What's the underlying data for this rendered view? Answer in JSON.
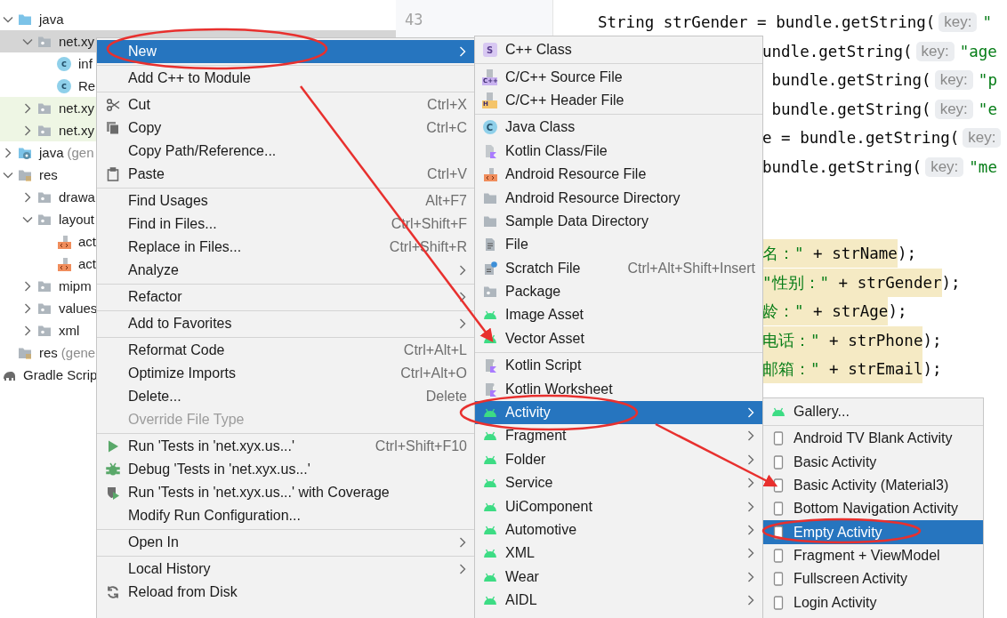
{
  "project_tree": [
    {
      "label": "java",
      "kind": "java-folder",
      "expanded": true,
      "selected": false,
      "test": false,
      "children": [
        {
          "label": "net.xy",
          "kind": "package",
          "expanded": true,
          "selected": true,
          "test": false,
          "children": [
            {
              "label": "inf",
              "kind": "class",
              "badge": "c",
              "selected": false,
              "test": false
            },
            {
              "label": "Re",
              "kind": "class",
              "badge": "c",
              "selected": false,
              "test": false
            }
          ]
        },
        {
          "label": "net.xy",
          "kind": "package",
          "expanded": false,
          "selected": false,
          "test": true
        },
        {
          "label": "net.xy",
          "kind": "package",
          "expanded": false,
          "selected": false,
          "test": true
        }
      ]
    },
    {
      "label": "java",
      "hint": "(gen",
      "kind": "gen-folder",
      "expanded": false,
      "selected": false,
      "test": false
    },
    {
      "label": "res",
      "kind": "res-folder",
      "expanded": true,
      "selected": false,
      "test": false,
      "children": [
        {
          "label": "drawa",
          "kind": "package",
          "expanded": false,
          "selected": false,
          "test": false
        },
        {
          "label": "layout",
          "kind": "package",
          "expanded": true,
          "selected": false,
          "test": false,
          "children": [
            {
              "label": "act",
              "kind": "resource-file",
              "selected": false,
              "test": false
            },
            {
              "label": "act",
              "kind": "resource-file",
              "selected": false,
              "test": false
            }
          ]
        },
        {
          "label": "mipm",
          "kind": "package",
          "expanded": false,
          "selected": false,
          "test": false
        },
        {
          "label": "values",
          "kind": "package",
          "expanded": false,
          "selected": false,
          "test": false
        },
        {
          "label": "xml",
          "kind": "package",
          "expanded": false,
          "selected": false,
          "test": false
        }
      ]
    },
    {
      "label": "res",
      "hint": "(gene",
      "kind": "res-folder",
      "selected": false,
      "test": false
    },
    {
      "label": "Gradle Scrip",
      "kind": "gradle",
      "selected": false,
      "test": false
    }
  ],
  "editor": {
    "line_number": "43",
    "lines": [
      {
        "kind": "full",
        "segments": [
          {
            "text": "String strGender = bundle.getString(",
            "kind": "code",
            "marked": false
          },
          {
            "text": "key:",
            "kind": "hint"
          },
          {
            "text": "\"",
            "kind": "string",
            "marked": false
          }
        ]
      },
      {
        "kind": "clipped",
        "segments": [
          {
            "text": "undle.getString(",
            "kind": "code",
            "marked": false
          },
          {
            "text": "key:",
            "kind": "hint"
          },
          {
            "text": "\"age",
            "kind": "string",
            "marked": false
          }
        ]
      },
      {
        "kind": "clipped",
        "segments": [
          {
            "text": " bundle.getString(",
            "kind": "code",
            "marked": false
          },
          {
            "text": "key:",
            "kind": "hint"
          },
          {
            "text": "\"p",
            "kind": "string",
            "marked": false
          }
        ]
      },
      {
        "kind": "clipped",
        "segments": [
          {
            "text": " bundle.getString(",
            "kind": "code",
            "marked": false
          },
          {
            "text": "key:",
            "kind": "hint"
          },
          {
            "text": "\"e",
            "kind": "string",
            "marked": false
          }
        ]
      },
      {
        "kind": "clipped",
        "segments": [
          {
            "text": "e = bundle.getString(",
            "kind": "code",
            "marked": false
          },
          {
            "text": "key:",
            "kind": "hint"
          }
        ]
      },
      {
        "kind": "clipped",
        "segments": [
          {
            "text": "bundle.getString(",
            "kind": "code",
            "marked": false
          },
          {
            "text": "key:",
            "kind": "hint"
          },
          {
            "text": "\"me",
            "kind": "string",
            "marked": false
          }
        ]
      },
      {
        "kind": "blank"
      },
      {
        "kind": "blank"
      },
      {
        "kind": "clipped",
        "segments": [
          {
            "text": "名：\"",
            "kind": "string",
            "marked": true
          },
          {
            "text": " + strName",
            "kind": "code",
            "marked": true
          },
          {
            "text": ");",
            "kind": "code",
            "marked": false
          }
        ]
      },
      {
        "kind": "clipped",
        "segments": [
          {
            "text": "\"性别：\"",
            "kind": "string",
            "marked": true
          },
          {
            "text": " + strGender",
            "kind": "code",
            "marked": true
          },
          {
            "text": ");",
            "kind": "code",
            "marked": false
          }
        ]
      },
      {
        "kind": "clipped",
        "segments": [
          {
            "text": "龄：\"",
            "kind": "string",
            "marked": true
          },
          {
            "text": " + strAge",
            "kind": "code",
            "marked": true
          },
          {
            "text": ");",
            "kind": "code",
            "marked": false
          }
        ]
      },
      {
        "kind": "clipped",
        "segments": [
          {
            "text": "电话：\"",
            "kind": "string",
            "marked": true
          },
          {
            "text": " + strPhone",
            "kind": "code",
            "marked": true
          },
          {
            "text": ");",
            "kind": "code",
            "marked": false
          }
        ]
      },
      {
        "kind": "clipped",
        "segments": [
          {
            "text": "邮箱：\"",
            "kind": "string",
            "marked": true
          },
          {
            "text": " + strEmail",
            "kind": "code",
            "marked": true
          },
          {
            "text": ");",
            "kind": "code",
            "marked": false
          }
        ]
      }
    ]
  },
  "context_menu": {
    "groups": [
      [
        {
          "label": "New",
          "selected": true,
          "submenu": true,
          "disabled": false
        }
      ],
      [
        {
          "label": "Add C++ to Module",
          "selected": false,
          "submenu": false,
          "disabled": false
        }
      ],
      [
        {
          "label": "Cut",
          "kind": "cut",
          "shortcut": "Ctrl+X",
          "selected": false,
          "submenu": false,
          "disabled": false
        },
        {
          "label": "Copy",
          "kind": "copy",
          "shortcut": "Ctrl+C",
          "selected": false,
          "submenu": false,
          "disabled": false
        },
        {
          "label": "Copy Path/Reference...",
          "selected": false,
          "submenu": false,
          "disabled": false
        },
        {
          "label": "Paste",
          "kind": "paste",
          "shortcut": "Ctrl+V",
          "selected": false,
          "submenu": false,
          "disabled": false
        }
      ],
      [
        {
          "label": "Find Usages",
          "shortcut": "Alt+F7",
          "selected": false,
          "submenu": false,
          "disabled": false
        },
        {
          "label": "Find in Files...",
          "shortcut": "Ctrl+Shift+F",
          "selected": false,
          "submenu": false,
          "disabled": false
        },
        {
          "label": "Replace in Files...",
          "shortcut": "Ctrl+Shift+R",
          "selected": false,
          "submenu": false,
          "disabled": false
        },
        {
          "label": "Analyze",
          "selected": false,
          "submenu": true,
          "disabled": false
        }
      ],
      [
        {
          "label": "Refactor",
          "selected": false,
          "submenu": true,
          "disabled": false
        }
      ],
      [
        {
          "label": "Add to Favorites",
          "selected": false,
          "submenu": true,
          "disabled": false
        }
      ],
      [
        {
          "label": "Reformat Code",
          "shortcut": "Ctrl+Alt+L",
          "selected": false,
          "submenu": false,
          "disabled": false
        },
        {
          "label": "Optimize Imports",
          "shortcut": "Ctrl+Alt+O",
          "selected": false,
          "submenu": false,
          "disabled": false
        },
        {
          "label": "Delete...",
          "shortcut": "Delete",
          "selected": false,
          "submenu": false,
          "disabled": false
        },
        {
          "label": "Override File Type",
          "selected": false,
          "submenu": false,
          "disabled": true
        }
      ],
      [
        {
          "label": "Run 'Tests in 'net.xyx.us...'",
          "kind": "run",
          "shortcut": "Ctrl+Shift+F10",
          "selected": false,
          "submenu": false,
          "disabled": false
        },
        {
          "label": "Debug 'Tests in 'net.xyx.us...'",
          "kind": "debug",
          "selected": false,
          "submenu": false,
          "disabled": false
        },
        {
          "label": "Run 'Tests in 'net.xyx.us...' with Coverage",
          "kind": "coverage",
          "selected": false,
          "submenu": false,
          "disabled": false
        },
        {
          "label": "Modify Run Configuration...",
          "selected": false,
          "submenu": false,
          "disabled": false
        }
      ],
      [
        {
          "label": "Open In",
          "selected": false,
          "submenu": true,
          "disabled": false
        }
      ],
      [
        {
          "label": "Local History",
          "selected": false,
          "submenu": true,
          "disabled": false
        },
        {
          "label": "Reload from Disk",
          "kind": "reload",
          "selected": false,
          "submenu": false,
          "disabled": false
        }
      ]
    ]
  },
  "new_submenu": {
    "groups": [
      [
        {
          "label": "C++ Class",
          "kind": "cpp-class",
          "badge": "S",
          "selected": false,
          "submenu": false
        }
      ],
      [
        {
          "label": "C/C++ Source File",
          "kind": "cpp-source",
          "badge": "C++",
          "selected": false,
          "submenu": false
        },
        {
          "label": "C/C++ Header File",
          "kind": "cpp-header",
          "badge": "H",
          "selected": false,
          "submenu": false
        }
      ],
      [
        {
          "label": "Java Class",
          "kind": "java-class",
          "badge": "C",
          "selected": false,
          "submenu": false
        },
        {
          "label": "Kotlin Class/File",
          "kind": "kotlin-file",
          "selected": false,
          "submenu": false
        },
        {
          "label": "Android Resource File",
          "kind": "resource-file",
          "selected": false,
          "submenu": false
        },
        {
          "label": "Android Resource Directory",
          "kind": "folder",
          "selected": false,
          "submenu": false
        },
        {
          "label": "Sample Data Directory",
          "kind": "folder",
          "selected": false,
          "submenu": false
        },
        {
          "label": "File",
          "kind": "file",
          "selected": false,
          "submenu": false
        },
        {
          "label": "Scratch File",
          "kind": "scratch",
          "shortcut": "Ctrl+Alt+Shift+Insert",
          "selected": false,
          "submenu": false
        },
        {
          "label": "Package",
          "kind": "package",
          "selected": false,
          "submenu": false
        },
        {
          "label": "Image Asset",
          "kind": "android",
          "selected": false,
          "submenu": false
        },
        {
          "label": "Vector Asset",
          "kind": "android",
          "selected": false,
          "submenu": false
        }
      ],
      [
        {
          "label": "Kotlin Script",
          "kind": "kotlin-script",
          "selected": false,
          "submenu": false
        },
        {
          "label": "Kotlin Worksheet",
          "kind": "kotlin-script",
          "selected": false,
          "submenu": false
        },
        {
          "label": "Activity",
          "kind": "android",
          "selected": true,
          "submenu": true
        },
        {
          "label": "Fragment",
          "kind": "android",
          "selected": false,
          "submenu": true
        },
        {
          "label": "Folder",
          "kind": "android",
          "selected": false,
          "submenu": true
        },
        {
          "label": "Service",
          "kind": "android",
          "selected": false,
          "submenu": true
        },
        {
          "label": "UiComponent",
          "kind": "android",
          "selected": false,
          "submenu": true
        },
        {
          "label": "Automotive",
          "kind": "android",
          "selected": false,
          "submenu": true
        },
        {
          "label": "XML",
          "kind": "android",
          "selected": false,
          "submenu": true
        },
        {
          "label": "Wear",
          "kind": "android",
          "selected": false,
          "submenu": true
        },
        {
          "label": "AIDL",
          "kind": "android",
          "selected": false,
          "submenu": true
        }
      ]
    ]
  },
  "activity_submenu": {
    "groups": [
      [
        {
          "label": "Gallery...",
          "kind": "android",
          "selected": false
        }
      ],
      [
        {
          "label": "Android TV Blank Activity",
          "kind": "activity",
          "selected": false
        },
        {
          "label": "Basic Activity",
          "kind": "activity",
          "selected": false
        },
        {
          "label": "Basic Activity (Material3)",
          "kind": "activity",
          "selected": false
        },
        {
          "label": "Bottom Navigation Activity",
          "kind": "activity",
          "selected": false
        },
        {
          "label": "Empty Activity",
          "kind": "activity",
          "selected": true
        },
        {
          "label": "Fragment + ViewModel",
          "kind": "activity",
          "selected": false
        },
        {
          "label": "Fullscreen Activity",
          "kind": "activity",
          "selected": false
        },
        {
          "label": "Login Activity",
          "kind": "activity",
          "selected": false
        }
      ]
    ]
  }
}
